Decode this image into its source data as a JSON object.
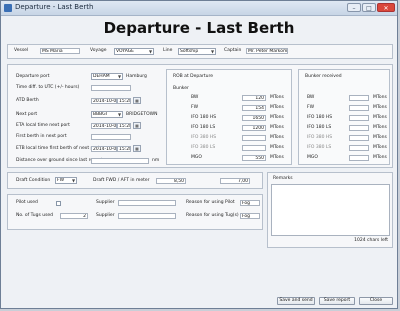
{
  "window": {
    "title": "Departure - Last Berth"
  },
  "heading": "Departure - Last Berth",
  "top": {
    "vessel_label": "Vessel",
    "vessel_value": "MS Maria",
    "voyage_label": "Voyage",
    "voyage_value": "VOYAGE",
    "line_label": "Line",
    "line_value": "Softship",
    "captain_label": "Captain",
    "captain_value": "Mr. Peter Markom"
  },
  "port": {
    "departure_port_label": "Departure port",
    "departure_port_code": "DEHAM",
    "departure_port_name": "Hamburg",
    "time_diff_label": "Time diff. to UTC (+/- hours)",
    "time_diff_value": "",
    "atd_label": "ATD Berth",
    "atd_date": "2014-10-08",
    "atd_time": "15:28",
    "next_port_label": "Next port",
    "next_port_code": "BBBGI",
    "next_port_name": "BRIDGETOWN",
    "eta_label": "ETA local time next port",
    "eta_date": "2014-10-08",
    "eta_time": "15:28",
    "first_berth_label": "First berth in next port",
    "first_berth_value": "",
    "etb_label": "ETB local time first berth of next port",
    "etb_date": "2014-10-08",
    "etb_time": "15:28",
    "distance_label": "Distance over ground since last report",
    "distance_value": "",
    "distance_unit": "nm"
  },
  "rob": {
    "title": "ROB at Departure",
    "bunker_label": "Bunker",
    "unit": "MTons",
    "rows": [
      {
        "label": "BW",
        "value": "120"
      },
      {
        "label": "FW",
        "value": "154"
      },
      {
        "label": "IFO 180 HS",
        "value": "1650"
      },
      {
        "label": "IFO 180 LS",
        "value": "1200"
      },
      {
        "label": "IFO 380 HS",
        "value": ""
      },
      {
        "label": "IFO 380 LS",
        "value": ""
      },
      {
        "label": "MGO",
        "value": "550"
      }
    ]
  },
  "bunker_received": {
    "title": "Bunker received",
    "unit": "MTons",
    "rows": [
      {
        "label": "BW",
        "value": ""
      },
      {
        "label": "FW",
        "value": ""
      },
      {
        "label": "IFO 180 HS",
        "value": ""
      },
      {
        "label": "IFO 180 LS",
        "value": ""
      },
      {
        "label": "IFO 380 HS",
        "value": ""
      },
      {
        "label": "IFO 380 LS",
        "value": ""
      },
      {
        "label": "MGO",
        "value": ""
      }
    ]
  },
  "draft": {
    "condition_label": "Draft Condition",
    "condition_value": "FW",
    "fwd_aft_label": "Draft FWD / AFT in meter",
    "fwd_value": "8,50",
    "aft_value": "7,00"
  },
  "remarks": {
    "label": "Remarks",
    "chars_left": "1024 chars left"
  },
  "tugs": {
    "pilot_label": "Pilot used",
    "tugs_label": "No. of Tugs used",
    "tugs_value": "2",
    "supplier_label": "Supplier",
    "reason_pilot_label": "Reason for using Pilot",
    "reason_pilot_value": "Fog",
    "reason_tugs_label": "Reason for using Tug(s)",
    "reason_tugs_value": "Fog"
  },
  "buttons": {
    "save_send": "Save and send",
    "save_report": "Save report",
    "close": "Close"
  }
}
